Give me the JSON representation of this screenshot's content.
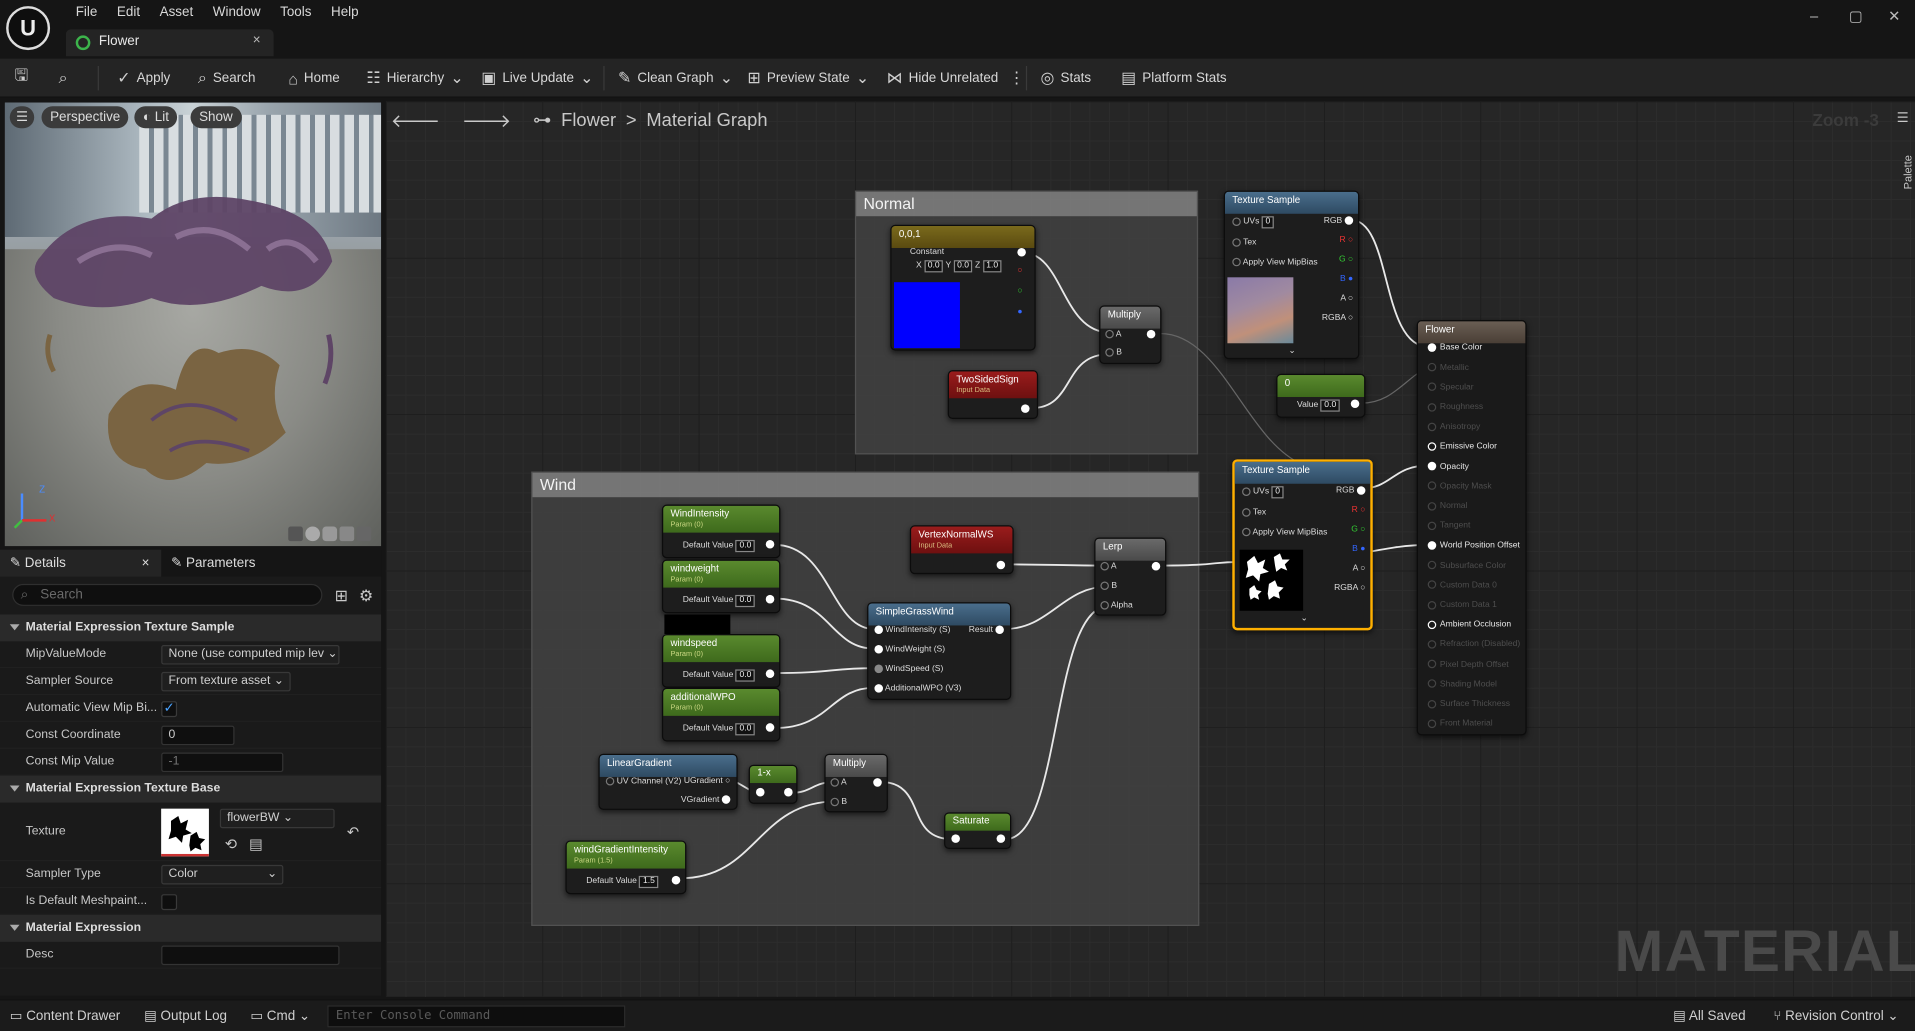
{
  "menu": [
    "File",
    "Edit",
    "Asset",
    "Window",
    "Tools",
    "Help"
  ],
  "doc_tab": {
    "label": "Flower",
    "close": "×"
  },
  "window_controls": {
    "min": "–",
    "max": "▢",
    "close": "✕"
  },
  "toolbar": {
    "apply": "Apply",
    "search": "Search",
    "home": "Home",
    "hierarchy": "Hierarchy",
    "live_update": "Live Update",
    "clean_graph": "Clean Graph",
    "preview_state": "Preview State",
    "hide_unrelated": "Hide Unrelated",
    "stats": "Stats",
    "platform_stats": "Platform Stats"
  },
  "viewport": {
    "perspective": "Perspective",
    "lit": "Lit",
    "show": "Show",
    "axis_x": "X",
    "axis_z": "Z"
  },
  "details": {
    "tab_details": "Details",
    "tab_parameters": "Parameters",
    "search_placeholder": "Search",
    "cat1": "Material Expression Texture Sample",
    "mip_label": "MipValueMode",
    "mip_value": "None (use computed mip lev",
    "sampler_source_label": "Sampler Source",
    "sampler_source_value": "From texture asset",
    "auto_mip_label": "Automatic View Mip Bi...",
    "const_coord_label": "Const Coordinate",
    "const_coord_value": "0",
    "const_mip_label": "Const Mip Value",
    "const_mip_value": "-1",
    "cat2": "Material Expression Texture Base",
    "texture_label": "Texture",
    "texture_value": "flowerBW",
    "sampler_type_label": "Sampler Type",
    "sampler_type_value": "Color",
    "default_mesh_label": "Is Default Meshpaint...",
    "cat3": "Material Expression",
    "desc_label": "Desc"
  },
  "graph": {
    "crumb_root": "Flower",
    "crumb_sep": ">",
    "crumb_child": "Material Graph",
    "zoom": "Zoom -3",
    "watermark": "MATERIAL",
    "palette": "Palette"
  },
  "comments": {
    "normal": "Normal",
    "wind": "Wind"
  },
  "nodes": {
    "const_title": "0,0,1",
    "const_label": "Constant",
    "const_x": "0.0",
    "const_y": "0.0",
    "const_z": "1.0",
    "two_sided": "TwoSidedSign",
    "input_data": "Input Data",
    "multiply": "Multiply",
    "pin_a": "A",
    "pin_b": "B",
    "tex1_title": "Texture Sample",
    "uvs": "UVs",
    "tex": "Tex",
    "apply_mip": "Apply View MipBias",
    "uvs_val": "0",
    "rgb": "RGB",
    "r": "R",
    "g": "G",
    "b": "B",
    "a": "A",
    "rgba": "RGBA",
    "zero_title": "0",
    "value_label": "Value",
    "value_val": "0.0",
    "tex2_title": "Texture Sample",
    "flower_title": "Flower",
    "flower_pins": [
      "Base Color",
      "Metallic",
      "Specular",
      "Roughness",
      "Anisotropy",
      "Emissive Color",
      "Opacity",
      "Opacity Mask",
      "Normal",
      "Tangent",
      "World Position Offset",
      "Subsurface Color",
      "Custom Data 0",
      "Custom Data 1",
      "Ambient Occlusion",
      "Refraction (Disabled)",
      "Pixel Depth Offset",
      "Shading Model",
      "Surface Thickness",
      "Front Material"
    ],
    "wind_intensity": "WindIntensity",
    "windweight": "windweight",
    "windspeed": "windspeed",
    "additional_wpo": "additionalWPO",
    "param_0": "Param (0)",
    "default_value": "Default Value",
    "dv0": "0.0",
    "vertex_normal": "VertexNormalWS",
    "sgw": "SimpleGrassWind",
    "sgw_in1": "WindIntensity (S)",
    "sgw_in2": "WindWeight (S)",
    "sgw_in3": "WindSpeed (S)",
    "sgw_in4": "AdditionalWPO (V3)",
    "result": "Result",
    "lerp": "Lerp",
    "alpha": "Alpha",
    "linear_gradient": "LinearGradient",
    "uv_channel": "UV Channel (V2)",
    "ugradient": "UGradient",
    "vgradient": "VGradient",
    "one_minus": "1-x",
    "saturate": "Saturate",
    "wgi": "windGradientIntensity",
    "param_15": "Param (1.5)",
    "dv15": "1.5"
  },
  "status": {
    "content_drawer": "Content Drawer",
    "output_log": "Output Log",
    "cmd": "Cmd",
    "console_placeholder": "Enter Console Command",
    "all_saved": "All Saved",
    "revision": "Revision Control"
  },
  "colors": {
    "accent": "#ffb000",
    "param": "#5a8a2e",
    "input": "#9a1c1c",
    "texture": "#4a6e8c"
  }
}
